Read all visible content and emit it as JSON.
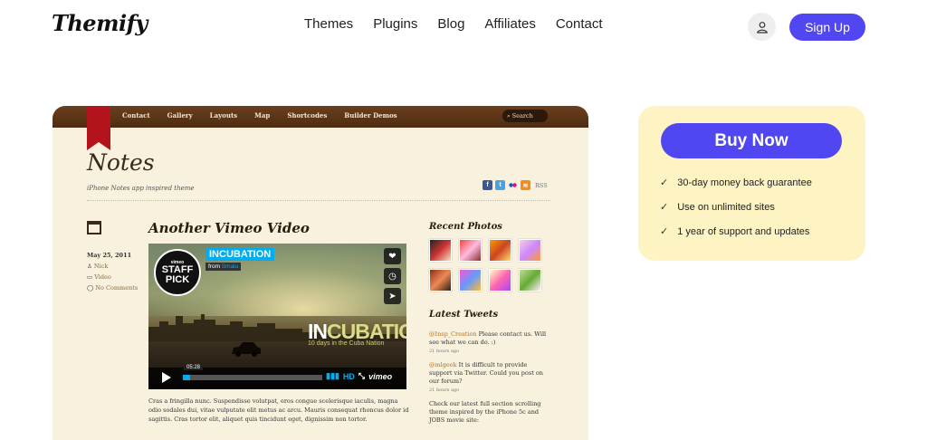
{
  "header": {
    "logo": "Themify",
    "nav": [
      "Themes",
      "Plugins",
      "Blog",
      "Affiliates",
      "Contact"
    ],
    "signup_label": "Sign Up"
  },
  "preview": {
    "menu": [
      "Contact",
      "Gallery",
      "Layouts",
      "Map",
      "Shortcodes",
      "Builder Demos"
    ],
    "search_label": "Search",
    "site_title": "Notes",
    "tagline": "iPhone Notes app inspired theme",
    "rss_label": "RSS",
    "post": {
      "title": "Another Vimeo Video",
      "date": "May 25, 2011",
      "author": "Nick",
      "category": "Video",
      "comments": "No Comments",
      "excerpt": "Cras a fringilla nunc. Suspendisse volutpat, eros congue scelerisque iaculis, magna odio sodales dui, vitae vulputate elit metus ac arcu. Mauris consequat rhoncus dolor id sagittis. Cras tortor elit, aliquet quis tincidunt eget, dignissim non tortor."
    },
    "video": {
      "badge_top": "vimeo",
      "badge_main": "STAFF PICK",
      "title": "INCUBATION",
      "from_prefix": "from",
      "from_name": "Smaiu",
      "big_title_a": "IN",
      "big_title_b": "CUBATION",
      "subtitle": "10 days in the Cuba Nation",
      "time": "05:28",
      "hd_label": "HD",
      "brand": "vimeo"
    },
    "sidebar": {
      "recent_photos_heading": "Recent Photos",
      "latest_tweets_heading": "Latest Tweets",
      "tweets": [
        {
          "handle": "@Insp_Creation",
          "text": "Please contact us. Will see what we can do. :)",
          "time": "21 hours ago"
        },
        {
          "handle": "@mlgeek",
          "text": "It is difficult to provide support via Twitter. Could you post on our forum?",
          "time": "21 hours ago"
        },
        {
          "handle": "",
          "text": "Check our latest full section scrolling theme inspired by the iPhone 5c and JOBS movie site:",
          "time": ""
        }
      ]
    }
  },
  "buy": {
    "button_label": "Buy Now",
    "features": [
      "30-day money back guarantee",
      "Use on unlimited sites",
      "1 year of support and updates"
    ]
  },
  "colors": {
    "accent": "#5147f2",
    "buybox_bg": "#fdf3c3",
    "preview_header": "#5a3417",
    "ribbon": "#b3141b"
  }
}
